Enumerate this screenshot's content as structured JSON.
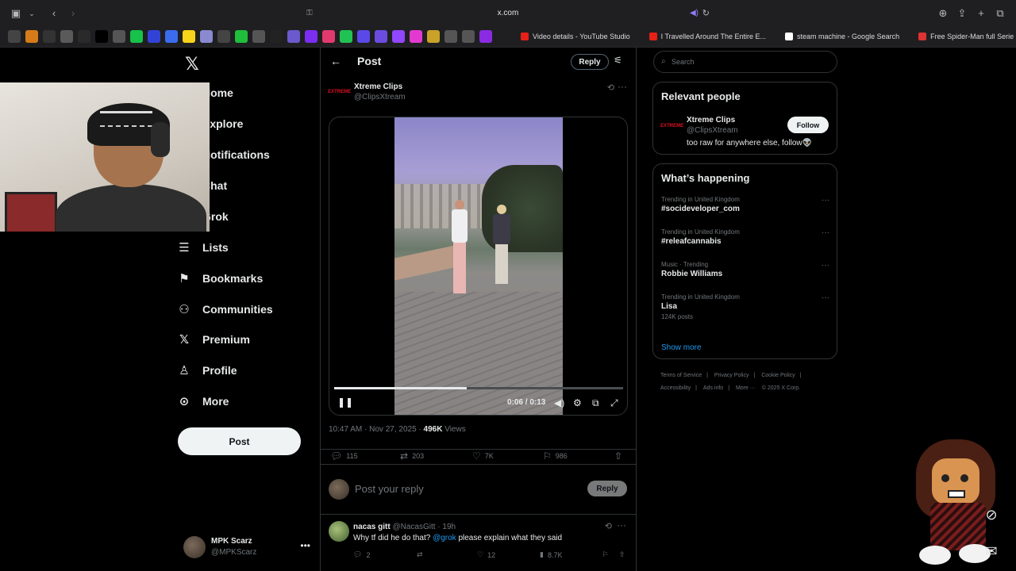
{
  "browser": {
    "url": "x.com",
    "tabs": [
      {
        "label": "Video details - YouTube Studio",
        "color": "#e62117"
      },
      {
        "label": "I Travelled Around The Entire E...",
        "color": "#e62117"
      },
      {
        "label": "steam machine - Google Search",
        "color": "#ffffff"
      },
      {
        "label": "Free Spider-Man full Serie HD...",
        "color": "#d33"
      }
    ],
    "favicons": [
      {
        "name": "bookmark-1-icon",
        "color": "#444"
      },
      {
        "name": "bookmark-2-icon",
        "color": "#d67b1a"
      },
      {
        "name": "bookmark-3-icon",
        "color": "#333"
      },
      {
        "name": "bookmark-4-icon",
        "color": "#5a5a5a"
      },
      {
        "name": "bookmark-5-icon",
        "color": "#2a2a2a"
      },
      {
        "name": "bookmark-x-icon",
        "color": "#000"
      },
      {
        "name": "bookmark-y-icon",
        "color": "#555"
      },
      {
        "name": "bookmark-6-icon",
        "color": "#17c24a"
      },
      {
        "name": "bookmark-7-icon",
        "color": "#3342d6"
      },
      {
        "name": "bookmark-8-icon",
        "color": "#3b6cf0"
      },
      {
        "name": "bookmark-9-icon",
        "color": "#f7d31b"
      },
      {
        "name": "bookmark-10-icon",
        "color": "#8a8ad0"
      },
      {
        "name": "bookmark-11-icon",
        "color": "#444"
      },
      {
        "name": "bookmark-12-icon",
        "color": "#1fbe3b"
      },
      {
        "name": "bookmark-13-icon",
        "color": "#555"
      },
      {
        "name": "bookmark-14-icon",
        "color": "#222"
      },
      {
        "name": "bookmark-15-icon",
        "color": "#6a5acd"
      },
      {
        "name": "bookmark-16-icon",
        "color": "#7b2df0"
      },
      {
        "name": "bookmark-17-icon",
        "color": "#e23a6e"
      },
      {
        "name": "bookmark-18-icon",
        "color": "#21c254"
      },
      {
        "name": "bookmark-19-icon",
        "color": "#5b48e8"
      },
      {
        "name": "bookmark-20-icon",
        "color": "#6a4ce0"
      },
      {
        "name": "bookmark-21-icon",
        "color": "#9146ff"
      },
      {
        "name": "bookmark-22-icon",
        "color": "#e23ad0"
      },
      {
        "name": "bookmark-23-icon",
        "color": "#c9a227"
      },
      {
        "name": "bookmark-24-icon",
        "color": "#555"
      },
      {
        "name": "bookmark-25-icon",
        "color": "#555"
      },
      {
        "name": "bookmark-26-icon",
        "color": "#8a2be2"
      }
    ]
  },
  "nav": {
    "items": [
      {
        "label": "Home",
        "icon": "home-icon",
        "glyph": "⌂"
      },
      {
        "label": "Explore",
        "icon": "search-icon",
        "glyph": "⌕"
      },
      {
        "label": "Notifications",
        "icon": "bell-icon",
        "glyph": "♪"
      },
      {
        "label": "Chat",
        "icon": "chat-icon",
        "glyph": "✉"
      },
      {
        "label": "Grok",
        "icon": "grok-icon",
        "glyph": "◩"
      },
      {
        "label": "Lists",
        "icon": "list-icon",
        "glyph": "☰"
      },
      {
        "label": "Bookmarks",
        "icon": "bookmark-icon",
        "glyph": "⚑"
      },
      {
        "label": "Communities",
        "icon": "communities-icon",
        "glyph": "⚇"
      },
      {
        "label": "Premium",
        "icon": "x-premium-icon",
        "glyph": "𝕏"
      },
      {
        "label": "Profile",
        "icon": "profile-icon",
        "glyph": "♙"
      },
      {
        "label": "More",
        "icon": "more-circle-icon",
        "glyph": "⊙"
      }
    ],
    "post_label": "Post",
    "account": {
      "name": "MPK Scarz",
      "handle": "@MPKScarz"
    }
  },
  "header": {
    "title": "Post",
    "reply_label": "Reply"
  },
  "post": {
    "author_name": "Xtreme Clips",
    "author_handle": "@ClipsXtream",
    "avatar_text": "EXTREME",
    "video": {
      "time": "0:06 / 0:13",
      "progress": 0.46
    },
    "timestamp": "10:47 AM · Nov 27, 2025 · ",
    "views_count": "496K",
    "views_label": " Views",
    "stats": {
      "replies": "115",
      "reposts": "203",
      "likes": "7K",
      "bookmarks": "986"
    }
  },
  "compose": {
    "placeholder": "Post your reply",
    "reply_label": "Reply"
  },
  "reply": {
    "name": "nacas gitt",
    "handle": "@NacasGitt · 19h",
    "text_before": "Why tf did he do that? ",
    "mention": "@grok",
    "text_after": " please explain what they said",
    "stats": {
      "replies": "2",
      "likes": "12",
      "views": "8.7K"
    }
  },
  "sidebar": {
    "search_placeholder": "Search",
    "relevant_title": "Relevant people",
    "person": {
      "name": "Xtreme Clips",
      "handle": "@ClipsXtream",
      "bio": "too raw for anywhere else, follow👽",
      "follow_label": "Follow",
      "avatar_text": "EXTREME"
    },
    "happening_title": "What’s happening",
    "trends": [
      {
        "context": "Trending in United Kingdom",
        "title": "#socideveloper_com",
        "count": ""
      },
      {
        "context": "Trending in United Kingdom",
        "title": "#releafcannabis",
        "count": ""
      },
      {
        "context": "Music · Trending",
        "title": "Robbie Williams",
        "count": ""
      },
      {
        "context": "Trending in United Kingdom",
        "title": "Lisa",
        "count": "124K posts"
      }
    ],
    "show_more": "Show more",
    "footer": {
      "terms": "Terms of Service",
      "privacy": "Privacy Policy",
      "cookie": "Cookie Policy",
      "accessibility": "Accessibility",
      "ads": "Ads info",
      "more": "More ···",
      "copyright": "© 2025 X Corp."
    }
  }
}
